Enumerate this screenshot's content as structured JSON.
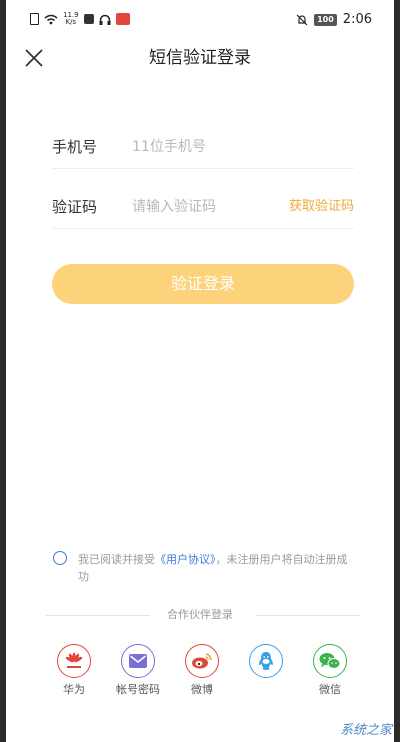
{
  "status_bar": {
    "net_speed_top": "11.9",
    "net_speed_bottom": "K/s",
    "battery": "100",
    "time": "2:06"
  },
  "header": {
    "title": "短信验证登录",
    "close_icon": "close-icon"
  },
  "form": {
    "phone_label": "手机号",
    "phone_placeholder": "11位手机号",
    "code_label": "验证码",
    "code_placeholder": "请输入验证码",
    "get_code_label": "获取验证码",
    "submit_label": "验证登录"
  },
  "agreement": {
    "prefix": "我已阅读并接受",
    "link": "《用户协议》",
    "suffix": "，未注册用户将自动注册成功"
  },
  "partners": {
    "heading": "合作伙伴登录",
    "items": [
      {
        "label": "华为",
        "icon": "huawei-icon",
        "color": "#e2463b"
      },
      {
        "label": "帐号密码",
        "icon": "mail-icon",
        "color": "#7b6fd6"
      },
      {
        "label": "微博",
        "icon": "weibo-icon",
        "color": "#e2463b"
      },
      {
        "label": "",
        "icon": "qq-icon",
        "color": "#3aa0e8"
      },
      {
        "label": "微信",
        "icon": "wechat-icon",
        "color": "#3cb34a"
      }
    ]
  },
  "colors": {
    "accent": "#f0a83a",
    "button": "#fcd27a",
    "link": "#3f7bd8"
  },
  "watermark": "系统之家"
}
